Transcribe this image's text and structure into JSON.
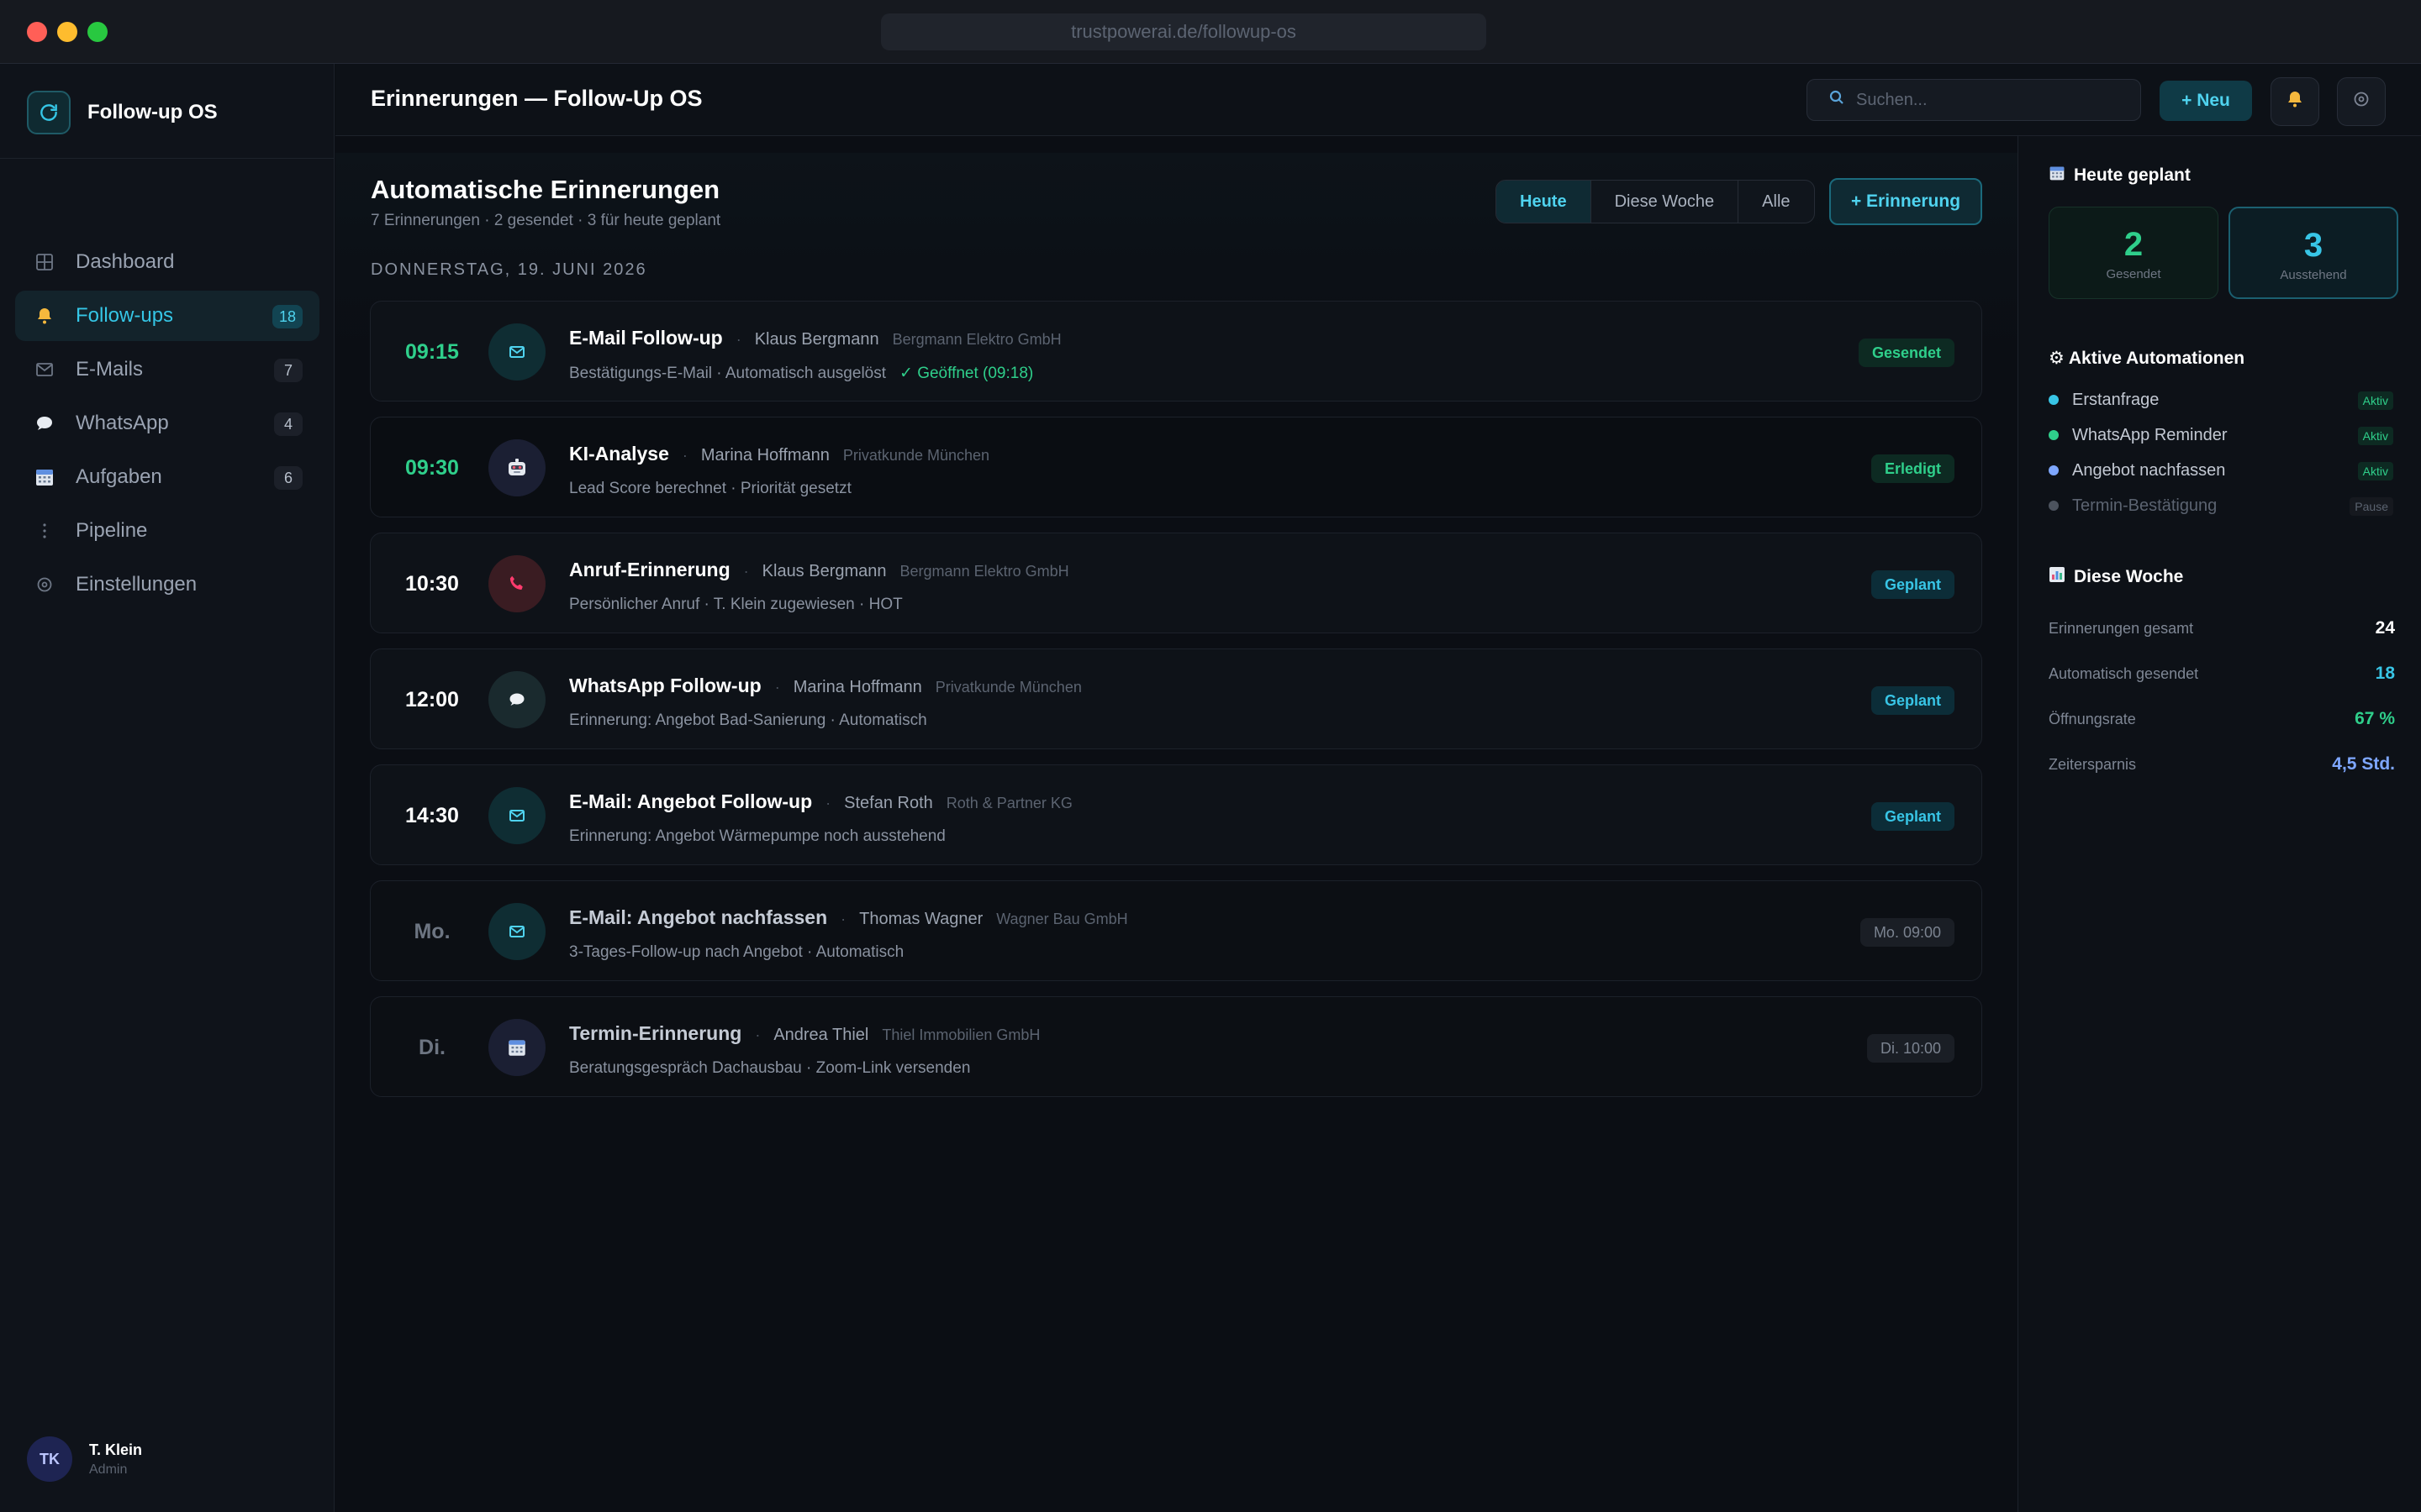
{
  "browser": {
    "url": "trustpowerai.de/followup-os"
  },
  "brand": {
    "name": "Follow-up OS"
  },
  "nav": [
    {
      "label": "Dashboard",
      "icon": "grid-icon",
      "badge": ""
    },
    {
      "label": "Follow-ups",
      "icon": "bell-icon",
      "badge": "18"
    },
    {
      "label": "E-Mails",
      "icon": "mail-icon",
      "badge": "7"
    },
    {
      "label": "WhatsApp",
      "icon": "chat-icon",
      "badge": "4"
    },
    {
      "label": "Aufgaben",
      "icon": "calendar-icon",
      "badge": "6"
    },
    {
      "label": "Pipeline",
      "icon": "dots-icon",
      "badge": ""
    },
    {
      "label": "Einstellungen",
      "icon": "gear-icon",
      "badge": ""
    }
  ],
  "user": {
    "initials": "TK",
    "name": "T. Klein",
    "role": "Admin"
  },
  "header": {
    "title": "Erinnerungen — Follow-Up OS",
    "search_placeholder": "Suchen...",
    "new_label": "+ Neu"
  },
  "main": {
    "title": "Automatische Erinnerungen",
    "subtitle": "7 Erinnerungen · 2 gesendet · 3 für heute geplant",
    "filters": [
      "Heute",
      "Diese Woche",
      "Alle"
    ],
    "add_label": "+ Erinnerung",
    "date": "DONNERSTAG, 19. JUNI 2026"
  },
  "reminders": [
    {
      "time": "09:15",
      "type": "mail",
      "title": "E-Mail Follow-up",
      "person": "Klaus Bergmann",
      "company": "Bergmann Elektro GmbH",
      "desc": "Bestätigungs-E-Mail · Automatisch ausgelöst",
      "extra": "✓ Geöffnet (09:18)",
      "status": "Gesendet"
    },
    {
      "time": "09:30",
      "type": "robot",
      "title": "KI-Analyse",
      "person": "Marina Hoffmann",
      "company": "Privatkunde München",
      "desc": "Lead Score berechnet · Priorität gesetzt",
      "extra": "",
      "status": "Erledigt"
    },
    {
      "time": "10:30",
      "type": "phone",
      "title": "Anruf-Erinnerung",
      "person": "Klaus Bergmann",
      "company": "Bergmann Elektro GmbH",
      "desc": "Persönlicher Anruf · T. Klein zugewiesen · HOT",
      "extra": "",
      "status": "Geplant"
    },
    {
      "time": "12:00",
      "type": "chat",
      "title": "WhatsApp Follow-up",
      "person": "Marina Hoffmann",
      "company": "Privatkunde München",
      "desc": "Erinnerung: Angebot Bad-Sanierung · Automatisch",
      "extra": "",
      "status": "Geplant"
    },
    {
      "time": "14:30",
      "type": "mail",
      "title": "E-Mail: Angebot Follow-up",
      "person": "Stefan Roth",
      "company": "Roth & Partner KG",
      "desc": "Erinnerung: Angebot Wärmepumpe noch ausstehend",
      "extra": "",
      "status": "Geplant"
    },
    {
      "time": "Mo.",
      "type": "mail",
      "title": "E-Mail: Angebot nachfassen",
      "person": "Thomas Wagner",
      "company": "Wagner Bau GmbH",
      "desc": "3-Tages-Follow-up nach Angebot · Automatisch",
      "extra": "",
      "status": "Mo. 09:00"
    },
    {
      "time": "Di.",
      "type": "calendar",
      "title": "Termin-Erinnerung",
      "person": "Andrea Thiel",
      "company": "Thiel Immobilien GmbH",
      "desc": "Beratungsgespräch Dachausbau · Zoom-Link versenden",
      "extra": "",
      "status": "Di. 10:00"
    }
  ],
  "panel": {
    "today": {
      "title": "Heute geplant",
      "sent": {
        "value": "2",
        "label": "Gesendet"
      },
      "pending": {
        "value": "3",
        "label": "Ausstehend"
      }
    },
    "automations": {
      "title": "⚙ Aktive Automationen",
      "items": [
        {
          "name": "Erstanfrage",
          "state": "Aktiv",
          "color": "#38c5e6"
        },
        {
          "name": "WhatsApp Reminder",
          "state": "Aktiv",
          "color": "#2fcf8b"
        },
        {
          "name": "Angebot nachfassen",
          "state": "Aktiv",
          "color": "#7ea7ff"
        },
        {
          "name": "Termin-Bestätigung",
          "state": "Pause",
          "color": "#4c535e"
        }
      ]
    },
    "week": {
      "title": "Diese Woche",
      "rows": [
        {
          "label": "Erinnerungen gesamt",
          "value": "24",
          "color": "#ffffff"
        },
        {
          "label": "Automatisch gesendet",
          "value": "18",
          "color": "#38c5e6"
        },
        {
          "label": "Öffnungsrate",
          "value": "67 %",
          "color": "#2fcf8b"
        },
        {
          "label": "Zeitersparnis",
          "value": "4,5 Std.",
          "color": "#7ea7ff"
        }
      ]
    }
  },
  "colors": {
    "accent": "#35c6e6",
    "success": "#2fcf8b",
    "background": "#0b0e14"
  }
}
